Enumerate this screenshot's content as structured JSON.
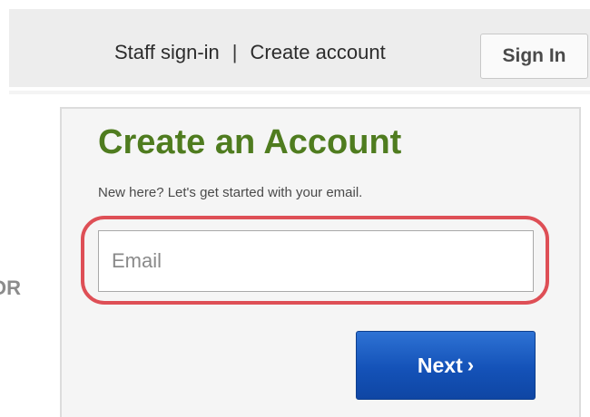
{
  "header": {
    "staff_signin": "Staff sign-in",
    "separator": "|",
    "create_account": "Create account",
    "signin_button": "Sign In"
  },
  "divider": {
    "or_label": "OR"
  },
  "card": {
    "title": "Create an Account",
    "subtitle": "New here? Let's get started with your email.",
    "email_placeholder": "Email",
    "next_button": "Next",
    "next_icon": "chevron-right-icon"
  },
  "colors": {
    "title_green": "#4f7c1f",
    "highlight_red": "#de4f56",
    "button_blue": "#1452b8"
  }
}
